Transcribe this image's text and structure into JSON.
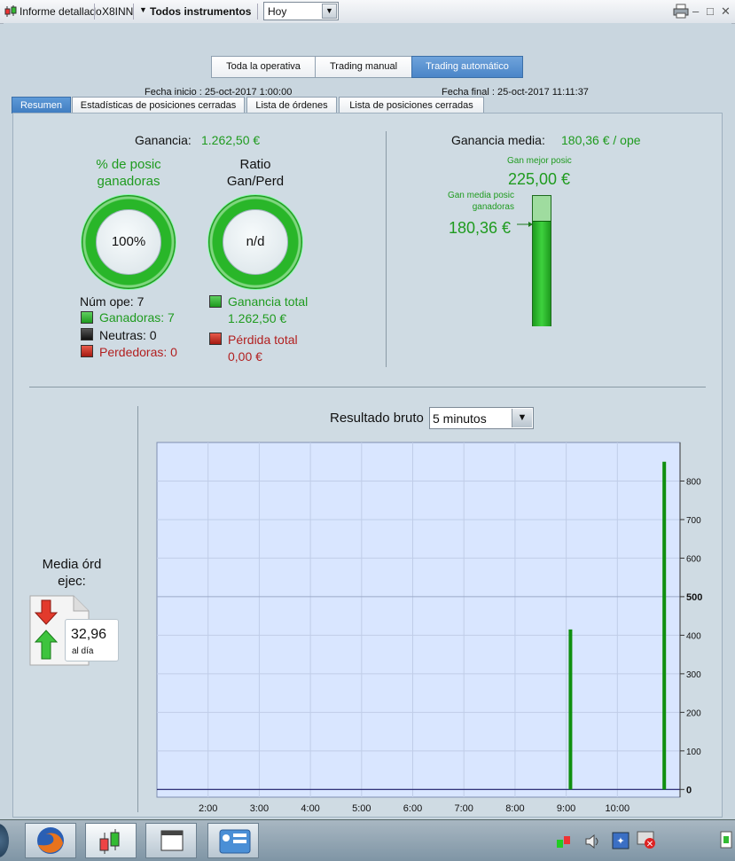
{
  "titlebar": {
    "report_label": "Informe detallado",
    "account": "X8INN",
    "instruments_label": "Todos instrumentos",
    "period_value": "Hoy"
  },
  "mode_tabs": [
    {
      "label": "Toda la operativa",
      "active": false
    },
    {
      "label": "Trading manual",
      "active": false
    },
    {
      "label": "Trading automático",
      "active": true
    }
  ],
  "dates": {
    "start": "Fecha inicio :  25-oct-2017 1:00:00",
    "end": "Fecha final :  25-oct-2017 11:11:37"
  },
  "tabs": [
    {
      "label": "Resumen",
      "active": true
    },
    {
      "label": "Estadísticas de posiciones cerradas",
      "active": false
    },
    {
      "label": "Lista de órdenes",
      "active": false
    },
    {
      "label": "Lista de posiciones cerradas",
      "active": false
    }
  ],
  "summary": {
    "gain_label": "Ganancia:",
    "gain_value": "1.262,50 €",
    "winpct_title_1": "% de posic",
    "winpct_title_2": "ganadoras",
    "winpct_value": "100%",
    "winpct_level": 1.0,
    "ratio_title_1": "Ratio",
    "ratio_title_2": "Gan/Perd",
    "ratio_value": "n/d",
    "num_ops": "Núm ope: 7",
    "winners": "Ganadoras: 7",
    "neutral": "Neutras: 0",
    "losers": "Perdedoras: 0",
    "total_gain_label": "Ganancia total",
    "total_gain_value": "1.262,50 €",
    "total_loss_label": "Pérdida total",
    "total_loss_value": "0,00 €",
    "avg_label": "Ganancia media:",
    "avg_value": "180,36 € / ope",
    "best_label": "Gan mejor posic",
    "best_value": "225,00 €",
    "avg_win_label_1": "Gan media posic",
    "avg_win_label_2": "ganadoras",
    "avg_win_value": "180,36 €",
    "colors": {
      "win": "#2fb52f",
      "neutral": "#222222",
      "loss": "#c0281e"
    }
  },
  "orders": {
    "label_1": "Media órd",
    "label_2": "ejec:",
    "value": "32,96",
    "unit": "al día"
  },
  "result_chart": {
    "title": "Resultado bruto",
    "interval_value": "5 minutos"
  },
  "chart_data": {
    "type": "bar",
    "title": "Resultado bruto",
    "x_ticks": [
      "2:00",
      "3:00",
      "4:00",
      "5:00",
      "6:00",
      "7:00",
      "8:00",
      "9:00",
      "10:00"
    ],
    "y_ticks": [
      0,
      100,
      200,
      300,
      400,
      500,
      600,
      700,
      800
    ],
    "ylim": [
      -20,
      900
    ],
    "grid": true,
    "series": [
      {
        "values": [
          {
            "x": "9:05",
            "y": 415
          },
          {
            "x": "10:55",
            "y": 850
          }
        ]
      }
    ],
    "color": "#0f8f0f"
  }
}
